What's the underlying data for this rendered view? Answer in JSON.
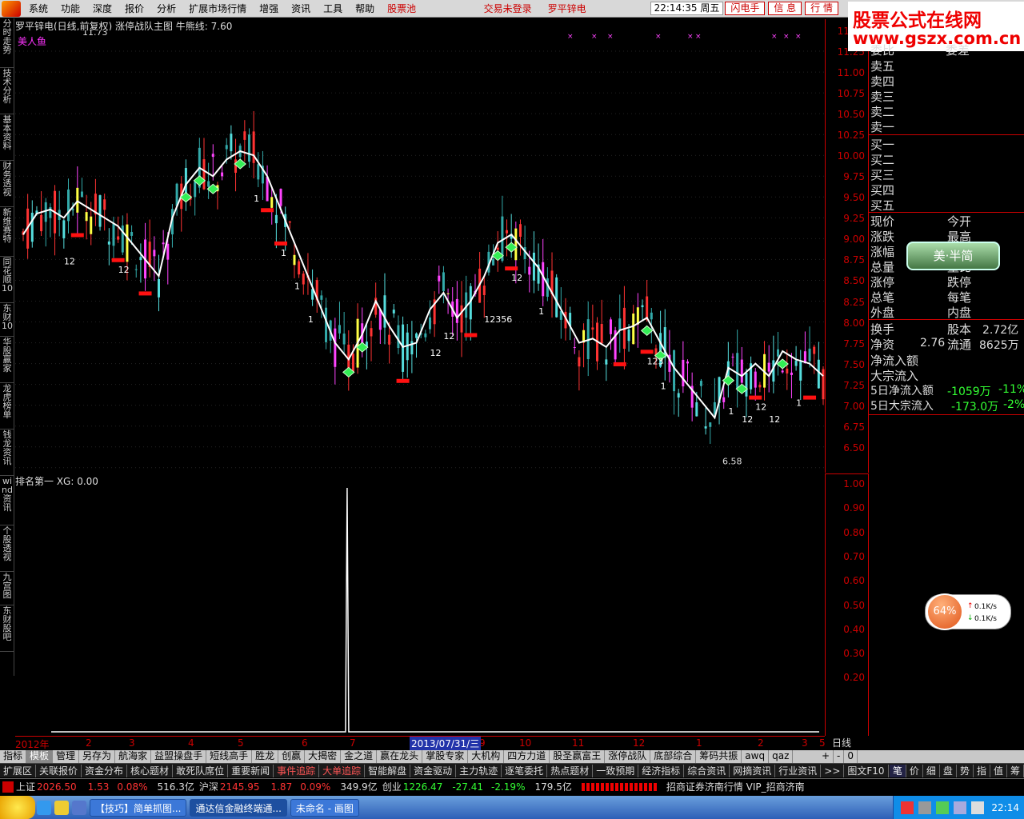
{
  "menu": {
    "items": [
      "系统",
      "功能",
      "深度",
      "报价",
      "分析",
      "扩展市场行情",
      "增强",
      "资讯",
      "工具",
      "帮助"
    ],
    "pool": "股票池",
    "trade_status": "交易未登录",
    "stock_name": "罗平锌电",
    "clock": "22:14:35 周五",
    "buttons": [
      "闪电手",
      "信  息",
      "行  情"
    ]
  },
  "brand": {
    "line1": "股票公式在线网",
    "line2": "www.gszx.com.cn"
  },
  "left_nav": [
    "分时走势",
    "技术分析",
    "基本资料",
    "财务透视",
    "新维赛特",
    "同花顺10",
    "东财10",
    "华股赢家",
    "龙虎榜单",
    "钱龙资讯",
    "wind资讯",
    "个股透视",
    "九宫图",
    "东财股吧"
  ],
  "chart": {
    "header": "罗平锌电(日线,前复权) 涨停战队主图  牛熊线: 7.60",
    "label": "美人鱼",
    "sub_header": "排名第一  XG: 0.00",
    "high_label": "11.73",
    "low_label": "6.58",
    "x_selected": "2013/07/31/三",
    "day_label": "日线"
  },
  "chart_data": [
    {
      "type": "candlestick",
      "title": "罗平锌电(日线,前复权) 涨停战队主图",
      "y_ticks": [
        "11.50",
        "11.25",
        "11.00",
        "10.75",
        "10.50",
        "10.25",
        "10.00",
        "9.75",
        "9.50",
        "9.25",
        "9.00",
        "8.75",
        "8.50",
        "8.25",
        "8.00",
        "7.75",
        "7.50",
        "7.25",
        "7.00",
        "6.75",
        "6.50"
      ],
      "ylim": [
        6.45,
        11.75
      ],
      "x_ticks": [
        "2012年",
        "2",
        "3",
        "4",
        "5",
        "6",
        "7",
        "2013/07/31/三",
        "9",
        "10",
        "11",
        "12",
        "1",
        "2",
        "3",
        "5"
      ],
      "ma_line": [
        9.3,
        9.55,
        9.6,
        9.5,
        9.7,
        9.6,
        9.5,
        9.4,
        9.2,
        9.0,
        8.8,
        9.5,
        9.9,
        10.1,
        10.0,
        10.2,
        10.3,
        10.25,
        10.0,
        9.6,
        9.2,
        8.8,
        8.4,
        8.0,
        7.8,
        8.1,
        8.5,
        8.2,
        7.95,
        8.0,
        8.4,
        8.6,
        8.3,
        8.5,
        8.8,
        9.2,
        9.3,
        9.1,
        8.9,
        8.6,
        8.3,
        8.0,
        8.05,
        7.95,
        8.15,
        8.2,
        8.3,
        8.0,
        7.7,
        7.5,
        7.3,
        7.1,
        7.7,
        7.6,
        7.75,
        7.6,
        7.9,
        7.8,
        7.75,
        7.6
      ],
      "annotations": [
        "12",
        "12",
        "12",
        "1",
        "1",
        "1",
        "1",
        "12",
        "12",
        "12",
        "12356",
        "1",
        "123",
        "1",
        "1",
        "12",
        "12",
        "1"
      ]
    },
    {
      "type": "line",
      "title": "排名第一",
      "y_ticks": [
        "1.00",
        "0.90",
        "0.80",
        "0.70",
        "0.60",
        "0.50",
        "0.40",
        "0.30",
        "0.20"
      ],
      "ylim": [
        0,
        1
      ],
      "spike_index": 0.41
    }
  ],
  "right_panel": {
    "top_left": "委比",
    "top_right": "委差",
    "sell": [
      "卖五",
      "卖四",
      "卖三",
      "卖二",
      "卖一"
    ],
    "buy": [
      "买一",
      "买二",
      "买三",
      "买四",
      "买五"
    ],
    "rows": [
      {
        "l": "现价",
        "r": "今开"
      },
      {
        "l": "涨跌",
        "r": "最高"
      },
      {
        "l": "涨幅",
        "r": "最低"
      },
      {
        "l": "总量",
        "r": "量比"
      },
      {
        "l": "涨停",
        "r": "跌停"
      },
      {
        "l": "总笔",
        "r": "每笔"
      },
      {
        "l": "外盘",
        "r": "内盘"
      }
    ],
    "turnover": "换手",
    "capital": "股本",
    "capital_v": "2.72亿",
    "net_asset": "净资",
    "net_asset_v": "2.76",
    "float": "流通",
    "float_v": "8625万",
    "net_in": "净流入额",
    "big_in": "大宗流入",
    "d5_net": "5日净流入额",
    "d5_net_v": "-1059万",
    "d5_net_p": "-11%",
    "d5_big": "5日大宗流入",
    "d5_big_v": "-173.0万",
    "d5_big_p": "-2%",
    "skin_btn": "美·半简"
  },
  "net_widget": {
    "percent": "64%",
    "up": "0.1K/s",
    "down": "0.1K/s"
  },
  "tabs1": [
    "指标",
    "模板",
    "管理",
    "另存为",
    "航海家",
    "益盟操盘手",
    "短线高手",
    "胜龙",
    "创赢",
    "大揭密",
    "金之道",
    "赢在龙头",
    "掌股专家",
    "大机构",
    "四方力道",
    "股圣赢富王",
    "涨停战队",
    "底部综合",
    "筹码共振",
    "awq",
    "qaz"
  ],
  "tabs1_right": [
    "+",
    "-",
    "0"
  ],
  "tabs2": [
    "扩展区",
    "关联报价",
    "资金分布",
    "核心题材",
    "敢死队席位",
    "重要新闻",
    "事件追踪",
    "大单追踪",
    "智能解盘",
    "资金驱动",
    "主力轨迹",
    "逐笔委托",
    "热点题材",
    "一致预期",
    "经济指标",
    "综合资讯",
    "网摘资讯",
    "行业资讯",
    ">>",
    "图文F10"
  ],
  "tabs2_right": [
    "笔",
    "价",
    "细",
    "盘",
    "势",
    "指",
    "值",
    "筹"
  ],
  "status": {
    "sh": "上证",
    "sh_v": "2026.50",
    "sh_c": "1.53",
    "sh_p": "0.08%",
    "sh_amt": "516.3亿",
    "sz": "沪深",
    "sz_v": "2145.95",
    "sz_c": "1.87",
    "sz_p": "0.09%",
    "sz_amt": "349.9亿",
    "cy": "创业",
    "cy_v": "1226.47",
    "cy_c": "-27.41",
    "cy_p": "-2.19%",
    "cy_amt": "179.5亿",
    "broker": "招商证券济南行情  VIP_招商济南"
  },
  "taskbar": {
    "items": [
      "【技巧】简单抓图...",
      "通达信金融终端通...",
      "未命名 - 画图"
    ],
    "time": "22:14"
  }
}
